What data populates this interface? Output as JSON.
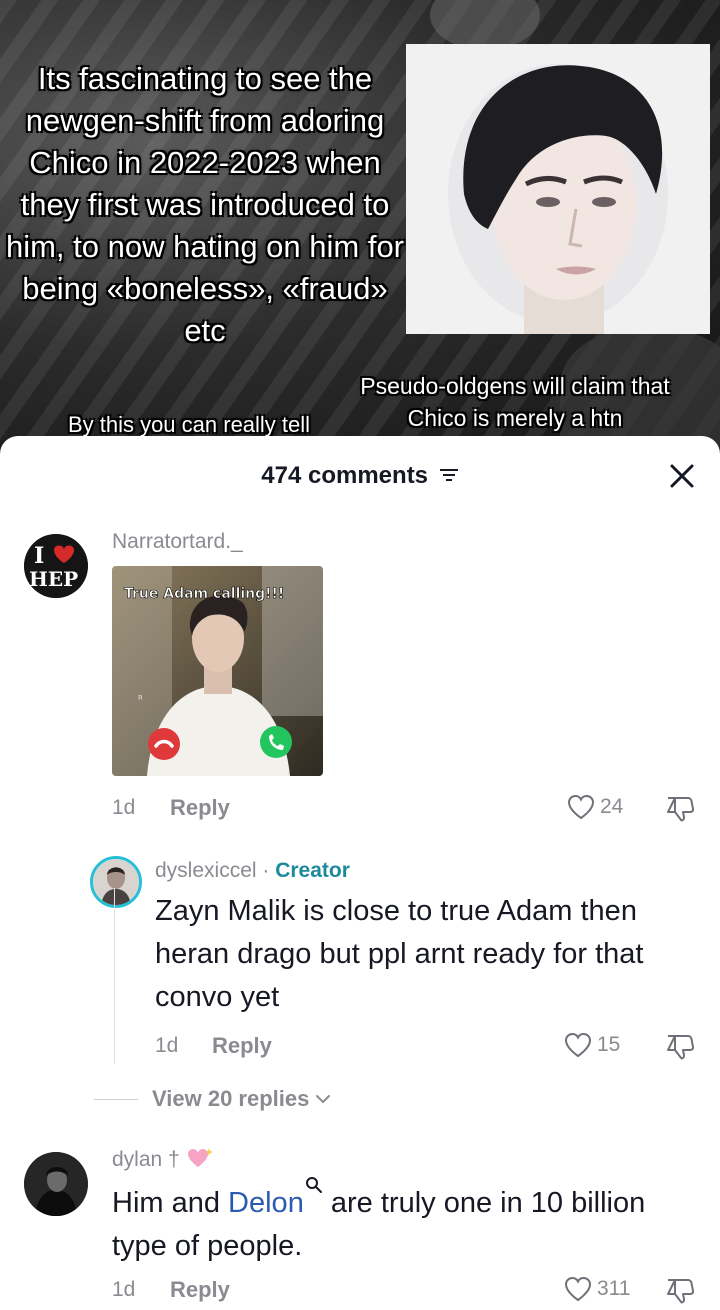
{
  "video": {
    "main_caption": "Its fascinating to see the newgen-shift from adoring Chico in 2022-2023 when they first was introduced to him, to now hating on him for being «boneless», «fraud» etc",
    "bottom_left_caption": "By this you can really tell",
    "bottom_right_caption": "Pseudo-oldgens will claim that Chico is merely a htn"
  },
  "sheet": {
    "comments_count": "474 comments",
    "filter_icon": "filter-icon",
    "close_icon": "close-icon"
  },
  "comments": [
    {
      "username": "Narratortard._",
      "avatar_text_line1": "I",
      "avatar_text_line2": "HEP",
      "gif_caption": "True Adam calling!!!",
      "gif_small_text": "R",
      "time": "1d",
      "reply_label": "Reply",
      "likes": "24"
    },
    {
      "username": "dyslexiccel",
      "separator": " · ",
      "badge": "Creator",
      "text": "Zayn Malik is close to true Adam then heran drago but ppl arnt ready for that convo yet",
      "time": "1d",
      "reply_label": "Reply",
      "likes": "15"
    },
    {
      "view_replies": "View 20 replies"
    },
    {
      "username": "dylan †",
      "text_before": "Him and ",
      "mention": "Delon",
      "text_after": " are truly one in 10 billion type of people.",
      "time": "1d",
      "reply_label": "Reply",
      "likes": "311"
    }
  ],
  "colors": {
    "accent_creator": "#1c8a9c",
    "mention": "#2b5bb0",
    "decline_call": "#e0393c",
    "accept_call": "#23c55e"
  }
}
